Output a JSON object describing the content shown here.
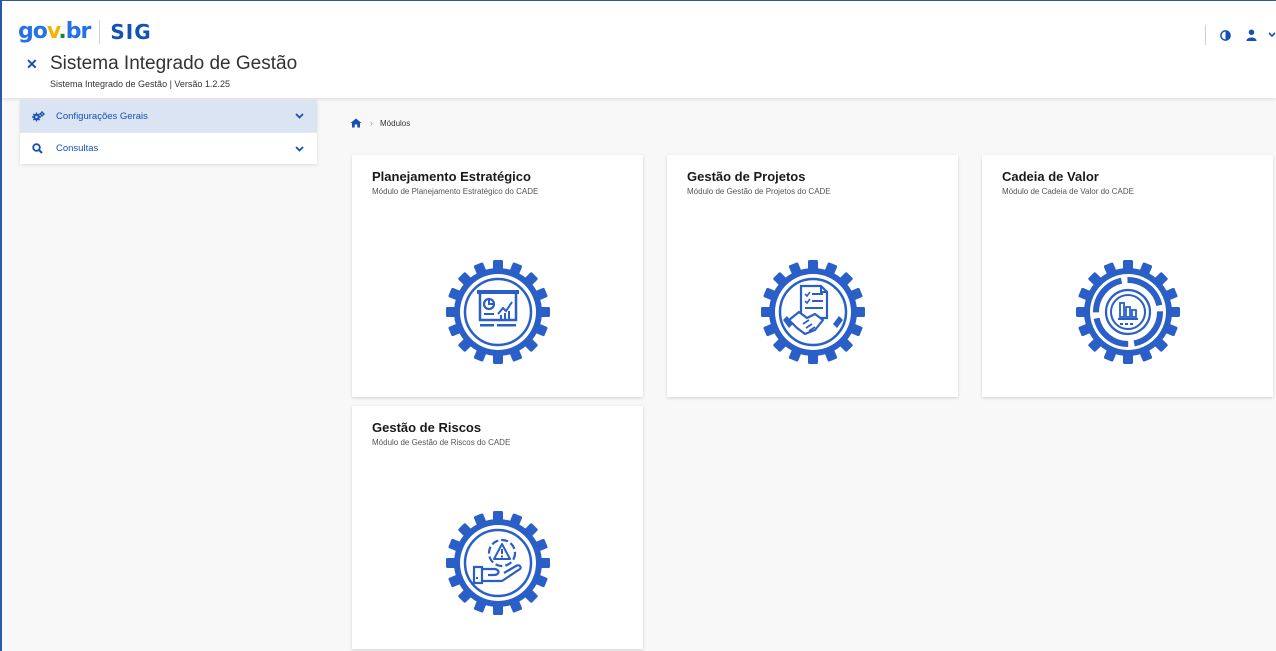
{
  "header": {
    "logo_gov": [
      "go",
      "v",
      ".",
      "br"
    ],
    "logo_sig": "SIG",
    "title": "Sistema Integrado de Gestão",
    "subtitle": "Sistema Integrado de Gestão | Versão 1.2.25",
    "menu_close_icon": "close-icon",
    "actions": [
      "contrast-icon",
      "user-icon",
      "chevron-down-icon"
    ]
  },
  "sidebar": {
    "items": [
      {
        "label": "Configurações Gerais",
        "icon": "gears-icon",
        "active": true
      },
      {
        "label": "Consultas",
        "icon": "search-icon",
        "active": false
      }
    ]
  },
  "breadcrumb": {
    "home_icon": "home-icon",
    "current": "Módulos"
  },
  "modules": [
    {
      "title": "Planejamento Estratégico",
      "description": "Módulo de Planejamento Estratégico do CADE",
      "icon": "presentation-board-gear-icon"
    },
    {
      "title": "Gestão de Projetos",
      "description": "Módulo de Gestão de Projetos do CADE",
      "icon": "handshake-document-gear-icon"
    },
    {
      "title": "Cadeia de Valor",
      "description": "Módulo de Cadeia de Valor do CADE",
      "icon": "value-chain-gear-icon"
    },
    {
      "title": "Gestão de Riscos",
      "description": "Módulo de Gestão de Riscos do CADE",
      "icon": "risk-warning-gear-icon"
    }
  ],
  "colors": {
    "primary": "#1351b4",
    "icon_blue": "#2a5fc7",
    "sidebar_active": "#dbe4f3",
    "background": "#f8f8f8"
  }
}
